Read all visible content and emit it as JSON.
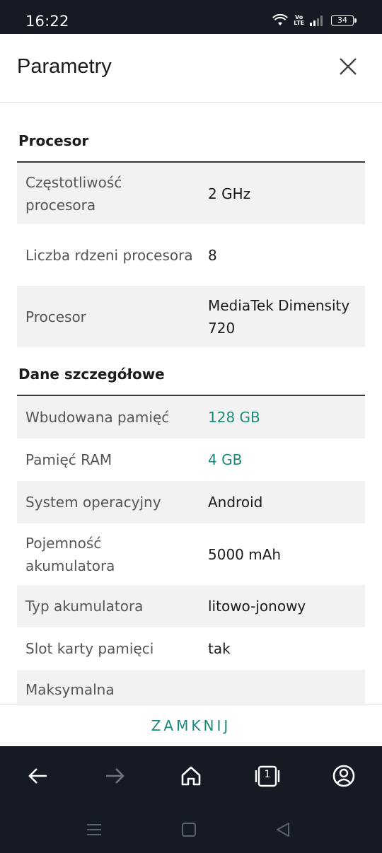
{
  "status_bar": {
    "time": "16:22",
    "volte_label": "Vo\nLTE",
    "battery": "34"
  },
  "header": {
    "title": "Parametry"
  },
  "sections": [
    {
      "title": "Procesor",
      "rows": [
        {
          "label": "Częstotliwość procesora",
          "value": "2 GHz"
        },
        {
          "label": "Liczba rdzeni procesora",
          "value": "8"
        },
        {
          "label": "Procesor",
          "value": "MediaTek Dimensity 720"
        }
      ]
    },
    {
      "title": "Dane szczegółowe",
      "rows": [
        {
          "label": "Wbudowana pamięć",
          "value": "128 GB"
        },
        {
          "label": "Pamięć RAM",
          "value": "4 GB"
        },
        {
          "label": "System operacyjny",
          "value": "Android"
        },
        {
          "label": "Pojemność akumulatora",
          "value": "5000 mAh"
        },
        {
          "label": "Typ akumulatora",
          "value": "litowo-jonowy"
        },
        {
          "label": "Slot karty pamięci",
          "value": "tak"
        },
        {
          "label": "Maksymalna",
          "value": ""
        }
      ]
    }
  ],
  "footer": {
    "close_label": "ZAMKNIJ"
  },
  "browser_nav": {
    "tabs_count": "1"
  },
  "colors": {
    "accent": "#1b8a7b",
    "system_bar": "#161a24",
    "row_shade": "#f2f2f2"
  }
}
